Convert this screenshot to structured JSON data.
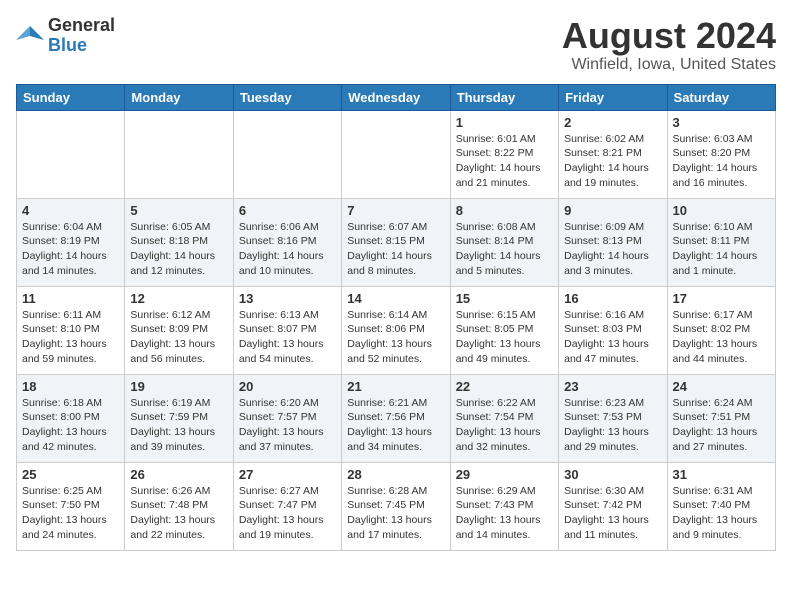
{
  "logo": {
    "general": "General",
    "blue": "Blue"
  },
  "title": "August 2024",
  "location": "Winfield, Iowa, United States",
  "days_header": [
    "Sunday",
    "Monday",
    "Tuesday",
    "Wednesday",
    "Thursday",
    "Friday",
    "Saturday"
  ],
  "weeks": [
    [
      {
        "day": "",
        "info": ""
      },
      {
        "day": "",
        "info": ""
      },
      {
        "day": "",
        "info": ""
      },
      {
        "day": "",
        "info": ""
      },
      {
        "day": "1",
        "info": "Sunrise: 6:01 AM\nSunset: 8:22 PM\nDaylight: 14 hours and 21 minutes."
      },
      {
        "day": "2",
        "info": "Sunrise: 6:02 AM\nSunset: 8:21 PM\nDaylight: 14 hours and 19 minutes."
      },
      {
        "day": "3",
        "info": "Sunrise: 6:03 AM\nSunset: 8:20 PM\nDaylight: 14 hours and 16 minutes."
      }
    ],
    [
      {
        "day": "4",
        "info": "Sunrise: 6:04 AM\nSunset: 8:19 PM\nDaylight: 14 hours and 14 minutes."
      },
      {
        "day": "5",
        "info": "Sunrise: 6:05 AM\nSunset: 8:18 PM\nDaylight: 14 hours and 12 minutes."
      },
      {
        "day": "6",
        "info": "Sunrise: 6:06 AM\nSunset: 8:16 PM\nDaylight: 14 hours and 10 minutes."
      },
      {
        "day": "7",
        "info": "Sunrise: 6:07 AM\nSunset: 8:15 PM\nDaylight: 14 hours and 8 minutes."
      },
      {
        "day": "8",
        "info": "Sunrise: 6:08 AM\nSunset: 8:14 PM\nDaylight: 14 hours and 5 minutes."
      },
      {
        "day": "9",
        "info": "Sunrise: 6:09 AM\nSunset: 8:13 PM\nDaylight: 14 hours and 3 minutes."
      },
      {
        "day": "10",
        "info": "Sunrise: 6:10 AM\nSunset: 8:11 PM\nDaylight: 14 hours and 1 minute."
      }
    ],
    [
      {
        "day": "11",
        "info": "Sunrise: 6:11 AM\nSunset: 8:10 PM\nDaylight: 13 hours and 59 minutes."
      },
      {
        "day": "12",
        "info": "Sunrise: 6:12 AM\nSunset: 8:09 PM\nDaylight: 13 hours and 56 minutes."
      },
      {
        "day": "13",
        "info": "Sunrise: 6:13 AM\nSunset: 8:07 PM\nDaylight: 13 hours and 54 minutes."
      },
      {
        "day": "14",
        "info": "Sunrise: 6:14 AM\nSunset: 8:06 PM\nDaylight: 13 hours and 52 minutes."
      },
      {
        "day": "15",
        "info": "Sunrise: 6:15 AM\nSunset: 8:05 PM\nDaylight: 13 hours and 49 minutes."
      },
      {
        "day": "16",
        "info": "Sunrise: 6:16 AM\nSunset: 8:03 PM\nDaylight: 13 hours and 47 minutes."
      },
      {
        "day": "17",
        "info": "Sunrise: 6:17 AM\nSunset: 8:02 PM\nDaylight: 13 hours and 44 minutes."
      }
    ],
    [
      {
        "day": "18",
        "info": "Sunrise: 6:18 AM\nSunset: 8:00 PM\nDaylight: 13 hours and 42 minutes."
      },
      {
        "day": "19",
        "info": "Sunrise: 6:19 AM\nSunset: 7:59 PM\nDaylight: 13 hours and 39 minutes."
      },
      {
        "day": "20",
        "info": "Sunrise: 6:20 AM\nSunset: 7:57 PM\nDaylight: 13 hours and 37 minutes."
      },
      {
        "day": "21",
        "info": "Sunrise: 6:21 AM\nSunset: 7:56 PM\nDaylight: 13 hours and 34 minutes."
      },
      {
        "day": "22",
        "info": "Sunrise: 6:22 AM\nSunset: 7:54 PM\nDaylight: 13 hours and 32 minutes."
      },
      {
        "day": "23",
        "info": "Sunrise: 6:23 AM\nSunset: 7:53 PM\nDaylight: 13 hours and 29 minutes."
      },
      {
        "day": "24",
        "info": "Sunrise: 6:24 AM\nSunset: 7:51 PM\nDaylight: 13 hours and 27 minutes."
      }
    ],
    [
      {
        "day": "25",
        "info": "Sunrise: 6:25 AM\nSunset: 7:50 PM\nDaylight: 13 hours and 24 minutes."
      },
      {
        "day": "26",
        "info": "Sunrise: 6:26 AM\nSunset: 7:48 PM\nDaylight: 13 hours and 22 minutes."
      },
      {
        "day": "27",
        "info": "Sunrise: 6:27 AM\nSunset: 7:47 PM\nDaylight: 13 hours and 19 minutes."
      },
      {
        "day": "28",
        "info": "Sunrise: 6:28 AM\nSunset: 7:45 PM\nDaylight: 13 hours and 17 minutes."
      },
      {
        "day": "29",
        "info": "Sunrise: 6:29 AM\nSunset: 7:43 PM\nDaylight: 13 hours and 14 minutes."
      },
      {
        "day": "30",
        "info": "Sunrise: 6:30 AM\nSunset: 7:42 PM\nDaylight: 13 hours and 11 minutes."
      },
      {
        "day": "31",
        "info": "Sunrise: 6:31 AM\nSunset: 7:40 PM\nDaylight: 13 hours and 9 minutes."
      }
    ]
  ]
}
